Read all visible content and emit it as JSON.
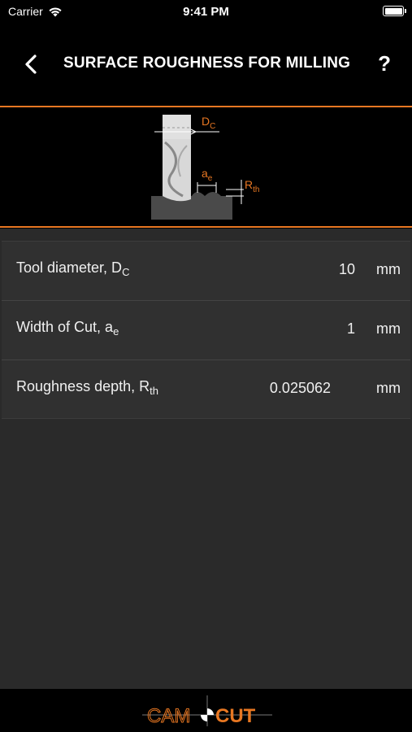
{
  "status": {
    "carrier": "Carrier",
    "time": "9:41 PM",
    "battery_level": 1.0
  },
  "nav": {
    "title": "SURFACE ROUGHNESS FOR MILLING",
    "help_label": "?"
  },
  "diagram": {
    "label_dc": "D",
    "label_dc_sub": "C",
    "label_ae": "a",
    "label_ae_sub": "e",
    "label_rth": "R",
    "label_rth_sub": "th"
  },
  "rows": [
    {
      "label": "Tool diameter, D",
      "label_sub": "C",
      "value": "10",
      "unit": "mm"
    },
    {
      "label": "Width of Cut, a",
      "label_sub": "e",
      "value": "1",
      "unit": "mm"
    },
    {
      "label": "Roughness depth, R",
      "label_sub": "th",
      "value": "0.025062",
      "unit": "mm"
    }
  ],
  "footer": {
    "logo_left": "CAM",
    "logo_right": "CUT"
  },
  "colors": {
    "accent": "#e87722",
    "background": "#2a2a2a",
    "table": "#303030"
  }
}
